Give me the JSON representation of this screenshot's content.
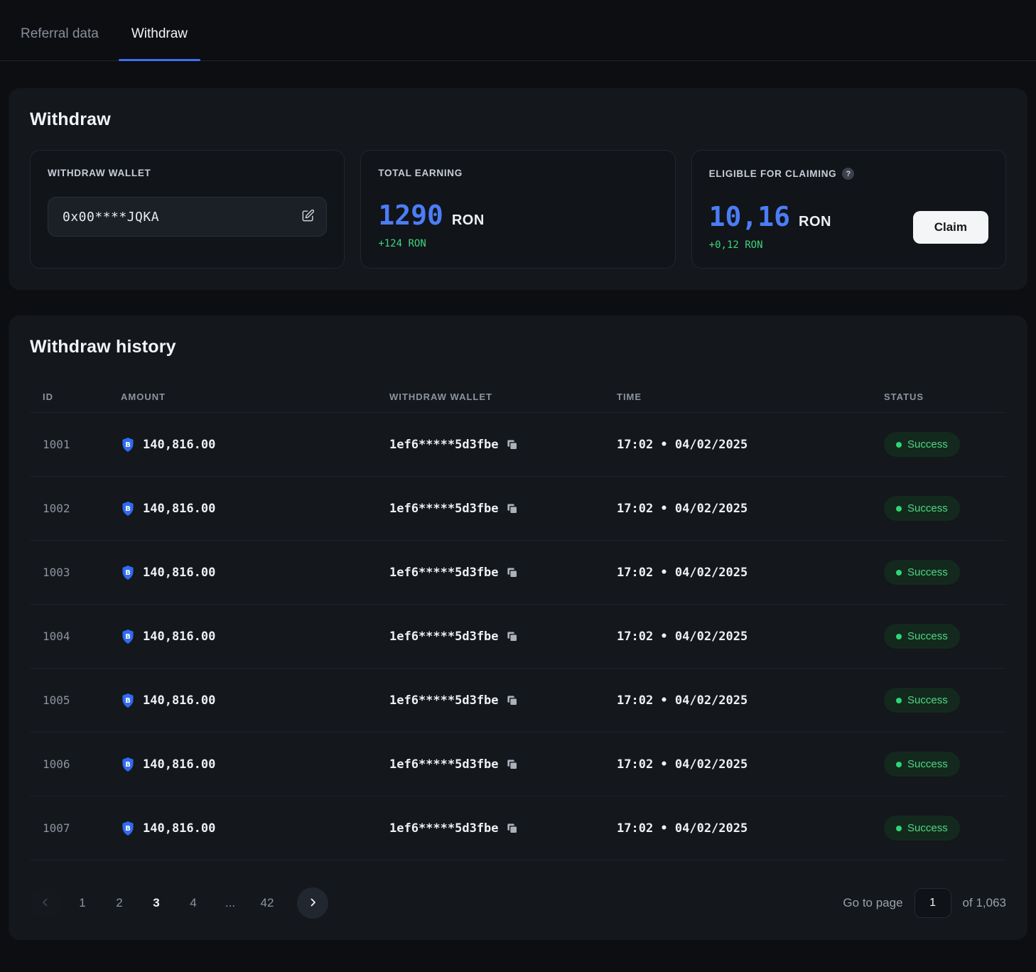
{
  "tabs": [
    {
      "label": "Referral data",
      "active": false
    },
    {
      "label": "Withdraw",
      "active": true
    }
  ],
  "withdraw": {
    "title": "Withdraw",
    "wallet": {
      "label": "WITHDRAW WALLET",
      "value": "0x00****JQKA"
    },
    "total_earning": {
      "label": "TOTAL EARNING",
      "value": "1290",
      "currency": "RON",
      "delta": "+124 RON"
    },
    "eligible": {
      "label": "ELIGIBLE FOR CLAIMING",
      "value": "10,16",
      "currency": "RON",
      "delta": "+0,12 RON",
      "claim_label": "Claim"
    }
  },
  "history": {
    "title": "Withdraw history",
    "columns": {
      "id": "ID",
      "amount": "AMOUNT",
      "wallet": "WITHDRAW WALLET",
      "time": "TIME",
      "status": "STATUS"
    },
    "rows": [
      {
        "id": "1001",
        "amount": "140,816.00",
        "wallet": "1ef6*****5d3fbe",
        "time": "17:02 • 04/02/2025",
        "status": "Success"
      },
      {
        "id": "1002",
        "amount": "140,816.00",
        "wallet": "1ef6*****5d3fbe",
        "time": "17:02 • 04/02/2025",
        "status": "Success"
      },
      {
        "id": "1003",
        "amount": "140,816.00",
        "wallet": "1ef6*****5d3fbe",
        "time": "17:02 • 04/02/2025",
        "status": "Success"
      },
      {
        "id": "1004",
        "amount": "140,816.00",
        "wallet": "1ef6*****5d3fbe",
        "time": "17:02 • 04/02/2025",
        "status": "Success"
      },
      {
        "id": "1005",
        "amount": "140,816.00",
        "wallet": "1ef6*****5d3fbe",
        "time": "17:02 • 04/02/2025",
        "status": "Success"
      },
      {
        "id": "1006",
        "amount": "140,816.00",
        "wallet": "1ef6*****5d3fbe",
        "time": "17:02 • 04/02/2025",
        "status": "Success"
      },
      {
        "id": "1007",
        "amount": "140,816.00",
        "wallet": "1ef6*****5d3fbe",
        "time": "17:02 • 04/02/2025",
        "status": "Success"
      }
    ],
    "pagination": {
      "pages": [
        "1",
        "2",
        "3",
        "4",
        "...",
        "42"
      ],
      "active_page": "3",
      "goto_label": "Go to page",
      "goto_value": "1",
      "total_label": "of 1,063"
    }
  },
  "icons": {
    "edit-icon": "pencil-square",
    "help-icon": "?",
    "token-icon": "blue-shield-B",
    "copy-icon": "⧉",
    "chevron-left-icon": "‹",
    "chevron-right-icon": "›",
    "status-dot": "●"
  },
  "colors": {
    "accent_blue": "#4c7df6",
    "positive_green": "#3ed57e",
    "badge_text_green": "#4fd684",
    "badge_bg": "#14291d",
    "card_bg": "#14171c",
    "page_bg": "#0c0e11",
    "tab_underline": "#3f6ef5"
  }
}
